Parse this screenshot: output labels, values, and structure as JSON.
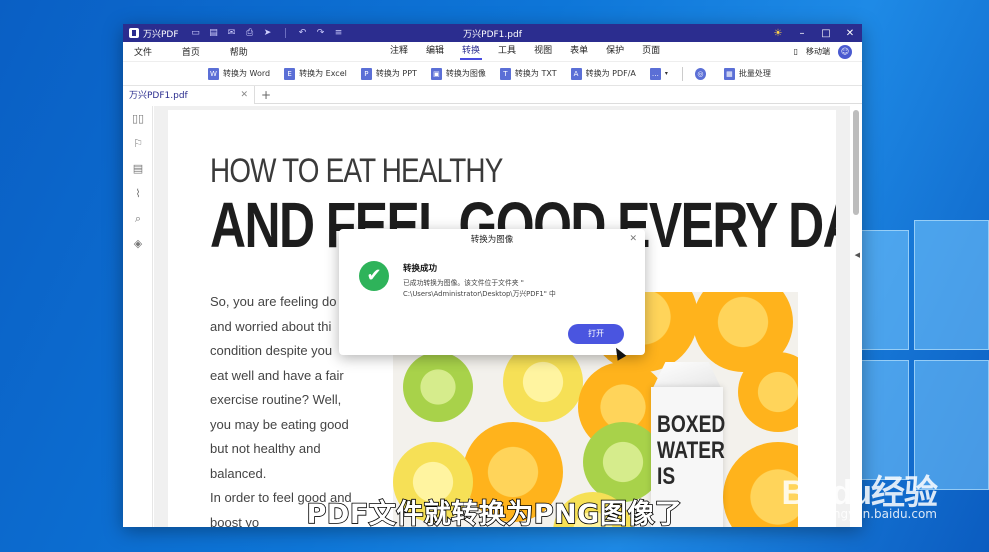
{
  "app": {
    "name": "万兴PDF",
    "doc_title": "万兴PDF1.pdf",
    "window_controls": [
      "sun-icon",
      "minimize",
      "maximize",
      "close"
    ]
  },
  "menu": {
    "left": [
      "文件",
      "首页",
      "帮助"
    ],
    "center": [
      "注释",
      "编辑",
      "转换",
      "工具",
      "视图",
      "表单",
      "保护",
      "页面"
    ],
    "active": "转换",
    "mobile_label": "移动端"
  },
  "toolbar": {
    "items": [
      {
        "label": "转换为 Word",
        "icon": "W"
      },
      {
        "label": "转换为 Excel",
        "icon": "E"
      },
      {
        "label": "转换为 PPT",
        "icon": "P"
      },
      {
        "label": "转换为图像",
        "icon": "▣"
      },
      {
        "label": "转换为 TXT",
        "icon": "T"
      },
      {
        "label": "转换为 PDF/A",
        "icon": "A"
      }
    ],
    "batch_label": "批量处理"
  },
  "tab": {
    "label": "万兴PDF1.pdf"
  },
  "document": {
    "heading1": "HOW TO EAT HEALTHY",
    "heading2": "AND FEEL GOOD EVERY DAY",
    "body_lines": [
      "So, you are feeling do",
      "and worried about thi",
      "condition despite you",
      "eat well and have a fair",
      "exercise routine? Well,",
      "you may be eating good",
      "but not healthy and",
      "balanced.",
      "In order to feel good and",
      "boost yo"
    ],
    "carton_text": [
      "BOXED",
      "WATER",
      "IS"
    ]
  },
  "dialog": {
    "title": "转换为图像",
    "heading": "转换成功",
    "message_line1": "已成功转换为图像。该文件位于文件夹 \"",
    "message_line2": "C:\\Users\\Administrator\\Desktop\\万兴PDF1\" 中",
    "open_button": "打开"
  },
  "caption": "PDF文件就转换为PNG图像了",
  "watermark": {
    "brand": "Baidu经验",
    "url": "jingyan.baidu.com"
  }
}
